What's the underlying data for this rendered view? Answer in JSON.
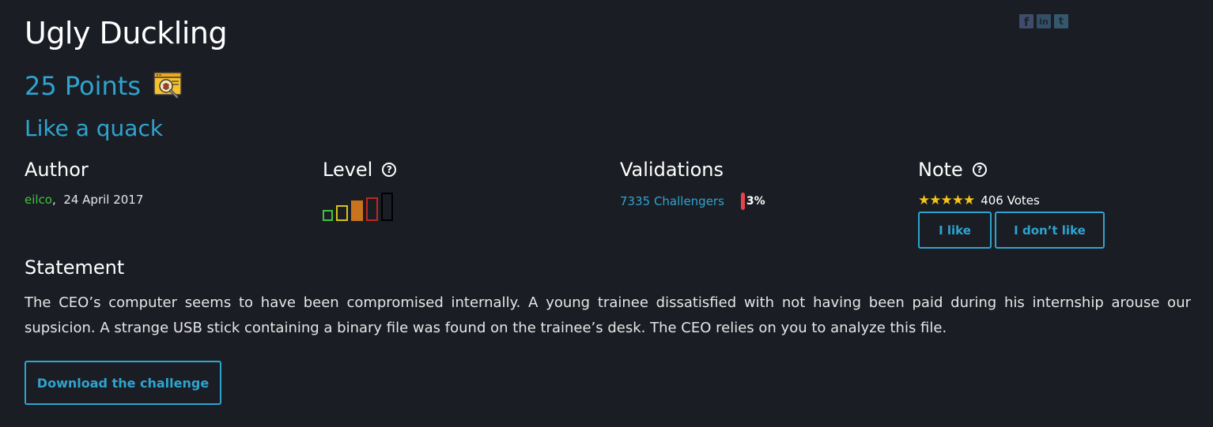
{
  "challenge": {
    "title": "Ugly Duckling",
    "points": "25 Points",
    "subtitle": "Like a quack"
  },
  "social": [
    {
      "icon": "facebook-icon",
      "glyph": "f"
    },
    {
      "icon": "linkedin-icon",
      "glyph": "in"
    },
    {
      "icon": "twitter-icon",
      "glyph": "t"
    }
  ],
  "author": {
    "heading": "Author",
    "name": "eilco",
    "date": "24 April 2017"
  },
  "level": {
    "heading": "Level",
    "help_glyph": "?",
    "current_level": 3,
    "max_level": 5,
    "colors": [
      "#3ec43e",
      "#d8c21a",
      "#c8741c",
      "#c0281e",
      "#111111"
    ]
  },
  "validations": {
    "heading": "Validations",
    "challengers": "7335 Challengers",
    "percent": "3%"
  },
  "note": {
    "heading": "Note",
    "help_glyph": "?",
    "stars": "★★★★★",
    "votes": "406 Votes",
    "like_label": "I like",
    "dislike_label": "I don’t like"
  },
  "statement": {
    "heading": "Statement",
    "text": "The CEO’s computer seems to have been compromised internally. A young trainee dissatisfied with not having been paid during his internship arouse our supsicion. A strange USB stick containing a binary file was found on the trainee’s desk. The CEO relies on you to analyze this file."
  },
  "download_label": "Download the challenge",
  "colors": {
    "background": "#1b1d24",
    "accent": "#2ea4cf",
    "author_link": "#3ec43e",
    "percent_bar": "#e8434a",
    "stars": "#f5c518"
  }
}
